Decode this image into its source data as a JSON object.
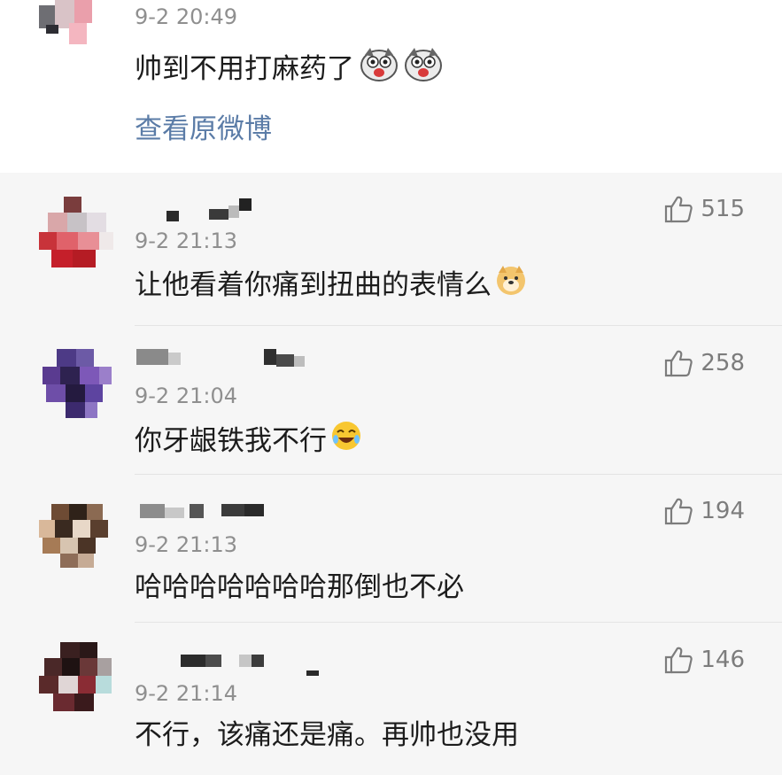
{
  "top_comment": {
    "time": "9-2 20:49",
    "text": "帅到不用打麻药了",
    "emojis": [
      "husky-emoji",
      "husky-emoji"
    ],
    "view_original": "查看原微博"
  },
  "comments": [
    {
      "time": "9-2 21:13",
      "text": "让他看着你痛到扭曲的表情么",
      "emoji": "doge-emoji",
      "likes": "515"
    },
    {
      "time": "9-2 21:04",
      "text": "你牙龈铁我不行",
      "emoji": "laugh-cry-emoji",
      "likes": "258"
    },
    {
      "time": "9-2 21:13",
      "text": "哈哈哈哈哈哈哈那倒也不必",
      "emoji": "",
      "likes": "194"
    },
    {
      "time": "9-2 21:14",
      "text": "不行，该痛还是痛。再帅也没用",
      "emoji": "",
      "likes": "146"
    }
  ],
  "icons": {
    "like": "thumbs-up-icon"
  },
  "colors": {
    "link": "#5b7ca7",
    "meta": "#8f8f8f",
    "background": "#f6f6f6"
  }
}
